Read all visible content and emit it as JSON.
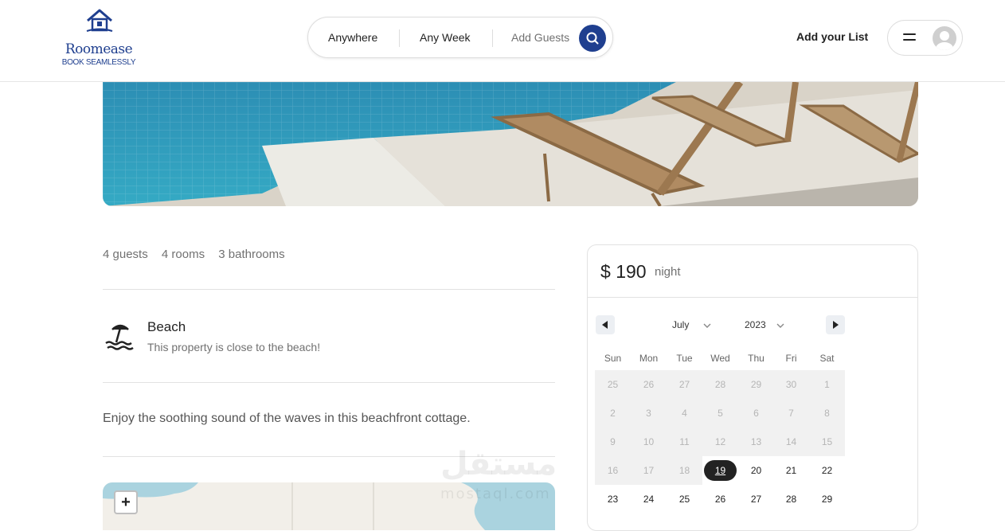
{
  "brand": {
    "name": "Roomease",
    "tagline": "BOOK SEAMLESSLY",
    "color": "#1f3f8f"
  },
  "search": {
    "location": "Anywhere",
    "week": "Any Week",
    "guests": "Add Guests",
    "button_icon": "search-icon"
  },
  "nav": {
    "add_list": "Add your List",
    "menu_icon": "hamburger-icon",
    "avatar_icon": "user-avatar-icon"
  },
  "listing": {
    "specs": [
      "4 guests",
      "4 rooms",
      "3 bathrooms"
    ],
    "feature": {
      "icon": "beach-umbrella-icon",
      "title": "Beach",
      "description": "This property is close to the beach!"
    },
    "description": "Enjoy the soothing sound of the waves in this beachfront cottage."
  },
  "map": {
    "zoom_in": "+"
  },
  "booking": {
    "currency": "$",
    "price": "190",
    "unit": "night",
    "calendar": {
      "month": "July",
      "year": "2023",
      "weekdays": [
        "Sun",
        "Mon",
        "Tue",
        "Wed",
        "Thu",
        "Fri",
        "Sat"
      ],
      "weeks": [
        [
          {
            "d": "25",
            "s": "disabled"
          },
          {
            "d": "26",
            "s": "disabled"
          },
          {
            "d": "27",
            "s": "disabled"
          },
          {
            "d": "28",
            "s": "disabled"
          },
          {
            "d": "29",
            "s": "disabled"
          },
          {
            "d": "30",
            "s": "disabled"
          },
          {
            "d": "1",
            "s": "disabled"
          }
        ],
        [
          {
            "d": "2",
            "s": "disabled"
          },
          {
            "d": "3",
            "s": "disabled"
          },
          {
            "d": "4",
            "s": "disabled"
          },
          {
            "d": "5",
            "s": "disabled"
          },
          {
            "d": "6",
            "s": "disabled"
          },
          {
            "d": "7",
            "s": "disabled"
          },
          {
            "d": "8",
            "s": "disabled"
          }
        ],
        [
          {
            "d": "9",
            "s": "disabled"
          },
          {
            "d": "10",
            "s": "disabled"
          },
          {
            "d": "11",
            "s": "disabled"
          },
          {
            "d": "12",
            "s": "disabled"
          },
          {
            "d": "13",
            "s": "disabled"
          },
          {
            "d": "14",
            "s": "disabled"
          },
          {
            "d": "15",
            "s": "disabled"
          }
        ],
        [
          {
            "d": "16",
            "s": "disabled"
          },
          {
            "d": "17",
            "s": "disabled"
          },
          {
            "d": "18",
            "s": "disabled"
          },
          {
            "d": "19",
            "s": "selected"
          },
          {
            "d": "20",
            "s": "active"
          },
          {
            "d": "21",
            "s": "active"
          },
          {
            "d": "22",
            "s": "active"
          }
        ],
        [
          {
            "d": "23",
            "s": "active"
          },
          {
            "d": "24",
            "s": "active"
          },
          {
            "d": "25",
            "s": "active"
          },
          {
            "d": "26",
            "s": "active"
          },
          {
            "d": "27",
            "s": "active"
          },
          {
            "d": "28",
            "s": "active"
          },
          {
            "d": "29",
            "s": "active"
          }
        ]
      ]
    }
  },
  "watermark": {
    "text": "مستقل",
    "sub": "mostaql.com"
  }
}
